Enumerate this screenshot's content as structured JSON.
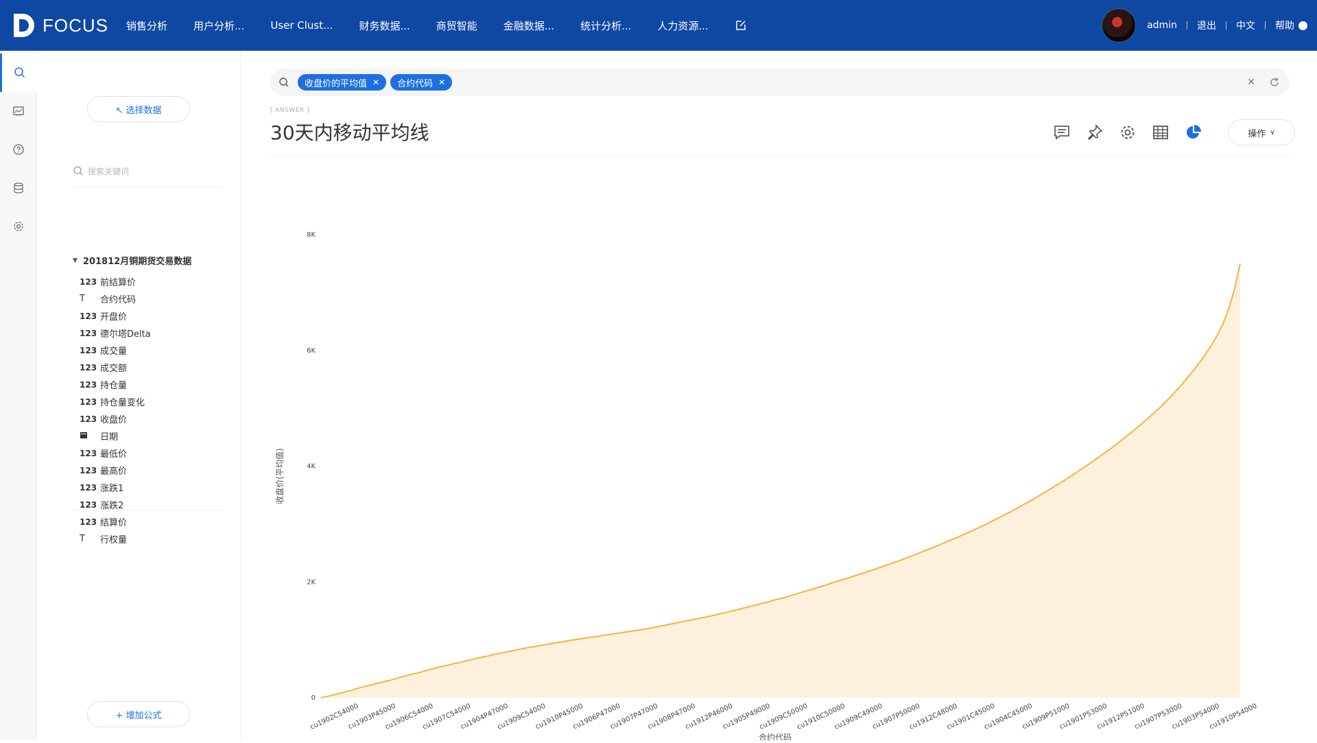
{
  "nav": {
    "logo_text": "FOCUS",
    "items": [
      "销售分析",
      "用户分析...",
      "User Clust...",
      "财务数据...",
      "商贸智能",
      "金融数据...",
      "统计分析...",
      "人力资源..."
    ],
    "username": "admin",
    "logout": "退出",
    "language": "中文",
    "help": "帮助"
  },
  "rail": {
    "icons": [
      "search-icon",
      "dashboard-icon",
      "help-icon",
      "database-icon",
      "settings-icon"
    ]
  },
  "panel": {
    "select_data_label": "↖ 选择数据",
    "search_placeholder": "搜索关键词",
    "dataset_name": "201812月铜期货交易数据",
    "add_formula_label": "+ 增加公式",
    "fields": [
      {
        "type": "123",
        "name": "前结算价"
      },
      {
        "type": "T",
        "name": "合约代码"
      },
      {
        "type": "123",
        "name": "开盘价"
      },
      {
        "type": "123",
        "name": "德尔塔Delta"
      },
      {
        "type": "123",
        "name": "成交量"
      },
      {
        "type": "123",
        "name": "成交额"
      },
      {
        "type": "123",
        "name": "持仓量"
      },
      {
        "type": "123",
        "name": "持仓量变化"
      },
      {
        "type": "123",
        "name": "收盘价"
      },
      {
        "type": "date",
        "name": "日期"
      },
      {
        "type": "123",
        "name": "最低价"
      },
      {
        "type": "123",
        "name": "最高价"
      },
      {
        "type": "123",
        "name": "涨跌1"
      },
      {
        "type": "123",
        "name": "涨跌2"
      },
      {
        "type": "123",
        "name": "结算价"
      },
      {
        "type": "T",
        "name": "行权量"
      }
    ]
  },
  "query": {
    "chips": [
      "收盘价的平均值",
      "合约代码"
    ]
  },
  "answer": {
    "tag": "[ ANSWER ]",
    "title": "30天内移动平均线",
    "ops_label": "操作"
  },
  "colors": {
    "nav_bg": "#0f48a3",
    "accent": "#1e6fe0",
    "series_line": "#f5b342",
    "series_fill": "#fdf0dc"
  },
  "chart_data": {
    "type": "area",
    "title": "",
    "xlabel": "合约代码",
    "ylabel": "收盘价(平均值)",
    "ylim": [
      0,
      8000
    ],
    "yticks": [
      0,
      2000,
      4000,
      6000,
      8000
    ],
    "ytick_labels": [
      "0",
      "2K",
      "4K",
      "6K",
      "8K"
    ],
    "grid": false,
    "x_tick_labels": [
      "cu1902C54000",
      "cu1903P45000",
      "cu1906C54000",
      "cu1907C54000",
      "cu1904P47000",
      "cu1909C54000",
      "cu1910P45000",
      "cu1906P47000",
      "cu1907P47000",
      "cu1908P47000",
      "cu1912P46000",
      "cu1905P49000",
      "cu1909C50000",
      "cu1910C50000",
      "cu1909C49000",
      "cu1907P50000",
      "cu1912C48000",
      "cu1901C45000",
      "cu1904C45000",
      "cu1909P51000",
      "cu1901P53000",
      "cu1912P51000",
      "cu1907P53000",
      "cu1903P54000",
      "cu1910P54000"
    ],
    "n_points": 160,
    "series": [
      {
        "values": [
          0,
          20,
          45,
          70,
          95,
          120,
          150,
          180,
          205,
          230,
          255,
          280,
          300,
          330,
          360,
          385,
          410,
          430,
          460,
          490,
          515,
          540,
          560,
          585,
          605,
          630,
          655,
          680,
          700,
          720,
          745,
          765,
          785,
          805,
          825,
          845,
          865,
          880,
          900,
          915,
          935,
          950,
          965,
          985,
          1000,
          1015,
          1030,
          1045,
          1060,
          1075,
          1090,
          1105,
          1120,
          1135,
          1150,
          1165,
          1180,
          1195,
          1215,
          1235,
          1255,
          1275,
          1295,
          1315,
          1335,
          1355,
          1375,
          1395,
          1415,
          1440,
          1460,
          1485,
          1510,
          1535,
          1560,
          1585,
          1610,
          1635,
          1660,
          1690,
          1715,
          1740,
          1770,
          1800,
          1830,
          1860,
          1890,
          1920,
          1950,
          1985,
          2015,
          2045,
          2075,
          2110,
          2140,
          2175,
          2205,
          2240,
          2275,
          2310,
          2345,
          2380,
          2420,
          2455,
          2495,
          2535,
          2575,
          2615,
          2655,
          2700,
          2740,
          2780,
          2825,
          2870,
          2915,
          2960,
          3010,
          3060,
          3110,
          3160,
          3210,
          3265,
          3320,
          3375,
          3430,
          3490,
          3550,
          3610,
          3670,
          3730,
          3795,
          3860,
          3925,
          3990,
          4060,
          4130,
          4200,
          4270,
          4345,
          4420,
          4500,
          4580,
          4660,
          4745,
          4830,
          4920,
          5010,
          5110,
          5210,
          5320,
          5430,
          5550,
          5670,
          5800,
          5940,
          6090,
          6260,
          6460,
          6720,
          7050,
          7500
        ]
      }
    ]
  }
}
